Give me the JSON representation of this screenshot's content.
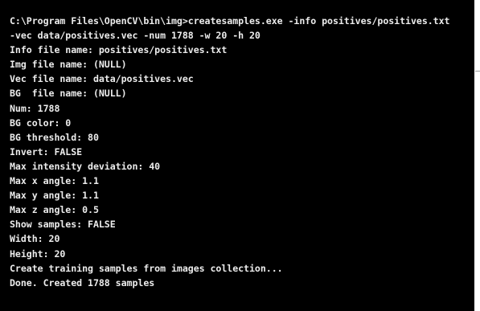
{
  "console": {
    "lines": [
      "C:\\Program Files\\OpenCV\\bin\\img>createsamples.exe -info positives/positives.txt",
      "-vec data/positives.vec -num 1788 -w 20 -h 20",
      "Info file name: positives/positives.txt",
      "Img file name: (NULL)",
      "Vec file name: data/positives.vec",
      "BG  file name: (NULL)",
      "Num: 1788",
      "BG color: 0",
      "BG threshold: 80",
      "Invert: FALSE",
      "Max intensity deviation: 40",
      "Max x angle: 1.1",
      "Max y angle: 1.1",
      "Max z angle: 0.5",
      "Show samples: FALSE",
      "Width: 20",
      "Height: 20",
      "Create training samples from images collection...",
      "Done. Created 1788 samples"
    ]
  },
  "colors": {
    "background": "#000000",
    "text": "#ececec"
  }
}
